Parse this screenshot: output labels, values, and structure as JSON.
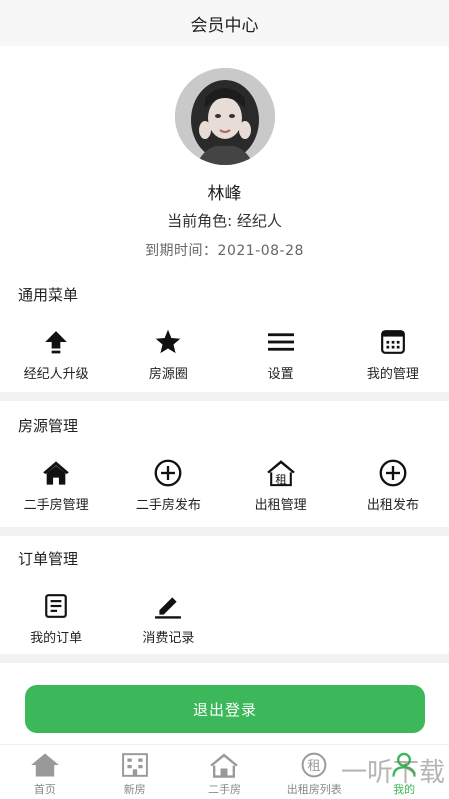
{
  "header": {
    "title": "会员中心"
  },
  "profile": {
    "name": "林峰",
    "role_text": "当前角色: 经纪人",
    "expire_text": "到期时间：2021-08-28"
  },
  "general_menu": {
    "title": "通用菜单",
    "items": [
      {
        "label": "经纪人升级",
        "icon": "upgrade-arrow-icon"
      },
      {
        "label": "房源圈",
        "icon": "star-icon"
      },
      {
        "label": "设置",
        "icon": "menu-lines-icon"
      },
      {
        "label": "我的管理",
        "icon": "calendar-icon"
      }
    ]
  },
  "property_mgmt": {
    "title": "房源管理",
    "items": [
      {
        "label": "二手房管理",
        "icon": "house-icon"
      },
      {
        "label": "二手房发布",
        "icon": "plus-circle-icon"
      },
      {
        "label": "出租管理",
        "icon": "rent-house-icon"
      },
      {
        "label": "出租发布",
        "icon": "plus-circle-icon"
      }
    ]
  },
  "order_mgmt": {
    "title": "订单管理",
    "items": [
      {
        "label": "我的订单",
        "icon": "document-icon"
      },
      {
        "label": "消费记录",
        "icon": "edit-pen-icon"
      }
    ]
  },
  "logout_label": "退出登录",
  "tabbar": {
    "items": [
      {
        "label": "首页",
        "icon": "home-icon",
        "active": false
      },
      {
        "label": "新房",
        "icon": "building-icon",
        "active": false
      },
      {
        "label": "二手房",
        "icon": "house-icon",
        "active": false
      },
      {
        "label": "出租房列表",
        "icon": "rent-icon",
        "active": false
      },
      {
        "label": "我的",
        "icon": "person-icon",
        "active": true
      }
    ],
    "rent_icon_char": "租"
  },
  "colors": {
    "accent": "#3cb85a",
    "text": "#222222",
    "muted": "#888888"
  },
  "watermark": {
    "text": "一听下载"
  }
}
